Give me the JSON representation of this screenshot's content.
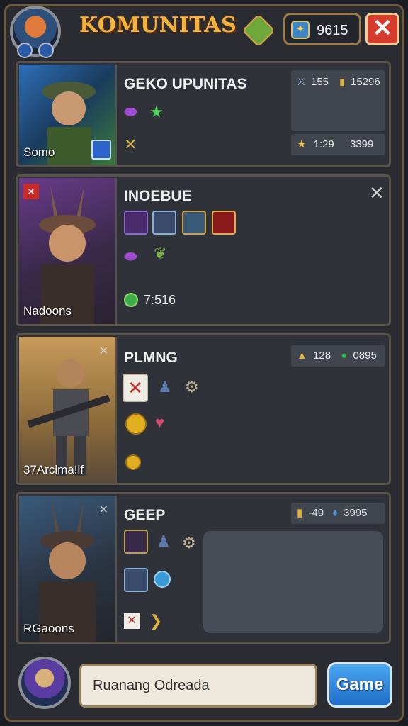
{
  "header": {
    "title": "KOMUNITAS",
    "currency_value": "9615",
    "close_label": "✕"
  },
  "cards": [
    {
      "name": "GEKO UPUNITAS",
      "portrait_name": "Somo",
      "stat1": "155",
      "stat2": "15296",
      "stat3": "1:29",
      "stat4": "3399"
    },
    {
      "name": "INOEBUE",
      "portrait_name": "Nadoons",
      "stat1": "7:516"
    },
    {
      "name": "PLMNG",
      "portrait_name": "37Arclma!lf",
      "stat1": "128",
      "stat2": "0895"
    },
    {
      "name": "GEEP",
      "portrait_name": "RGaoons",
      "stat1": "-49",
      "stat2": "3995"
    }
  ],
  "footer": {
    "input_value": "Ruanang Odreada",
    "button_label": "Game"
  },
  "colors": {
    "title": "#f2b43a",
    "close": "#d63a2a",
    "game_button": "#2a86dc"
  }
}
